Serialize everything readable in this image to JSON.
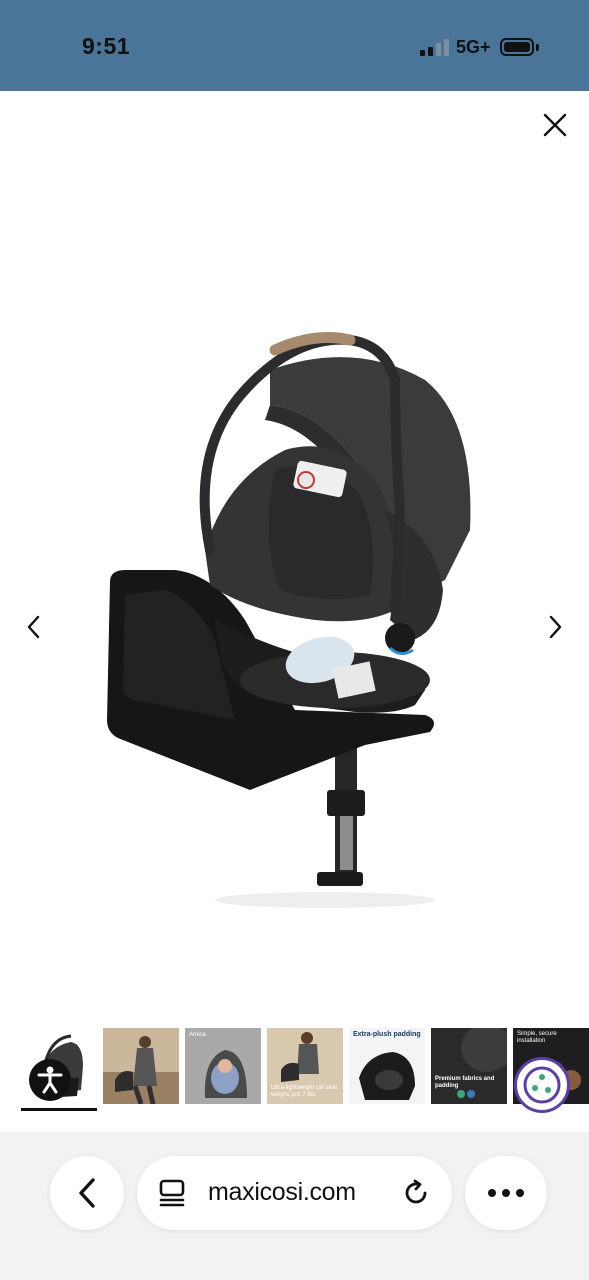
{
  "status_bar": {
    "time": "9:51",
    "network": "5G+",
    "signal_bars_active": 2,
    "signal_bars_total": 4,
    "battery_level": 0.85,
    "background_color": "#4a7598"
  },
  "viewer": {
    "close_icon": "close-icon",
    "prev_icon": "chevron-left-icon",
    "next_icon": "chevron-right-icon",
    "thumbnails": [
      {
        "caption": "",
        "active": true
      },
      {
        "caption": "",
        "active": false
      },
      {
        "caption": "Amica",
        "active": false
      },
      {
        "caption": "Ultra-lightweight car seat weighs just 7 lbs.",
        "active": false
      },
      {
        "caption": "Extra-plush padding",
        "active": false
      },
      {
        "caption": "Premium fabrics and padding",
        "active": false
      },
      {
        "caption": "Simple, secure installation",
        "active": false
      }
    ],
    "accessibility_icon": "accessibility-icon",
    "cookie_icon": "cookie-icon"
  },
  "browser": {
    "url": "maxicosi.com",
    "back_icon": "chevron-left-icon",
    "tabs_icon": "tabs-icon",
    "reload_icon": "reload-icon",
    "more_icon": "more-horizontal-icon"
  }
}
